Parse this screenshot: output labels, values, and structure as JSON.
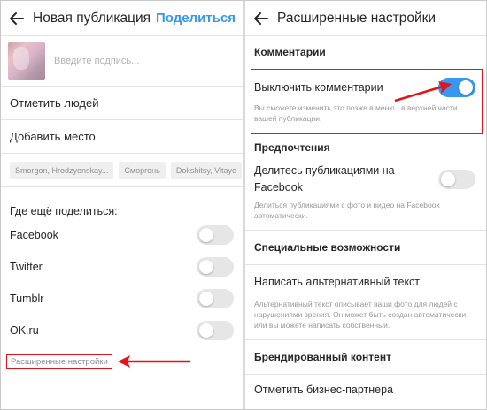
{
  "left": {
    "title": "Новая публикация",
    "share_label": "Поделиться",
    "back_icon": "back-arrow-icon",
    "caption_placeholder": "Введите подпись...",
    "tag_people": "Отметить людей",
    "add_location": "Добавить место",
    "location_chips": [
      "Smorgon, Hrodzyenskay...",
      "Сморгонь",
      "Dokshitsy, Vitaye"
    ],
    "share_elsewhere_label": "Где ещё поделиться:",
    "share_targets": [
      {
        "label": "Facebook",
        "on": false
      },
      {
        "label": "Twitter",
        "on": false
      },
      {
        "label": "Tumblr",
        "on": false
      },
      {
        "label": "OK.ru",
        "on": false
      }
    ],
    "advanced_settings": "Расширенные настройки"
  },
  "right": {
    "title": "Расширенные настройки",
    "back_icon": "back-arrow-icon",
    "comments_section": "Комментарии",
    "disable_comments": "Выключить комментарии",
    "disable_comments_on": true,
    "disable_comments_hint": "Вы сможете изменить это позже в меню ⁝ в верхней части вашей публикации.",
    "preferences_section": "Предпочтения",
    "share_fb_label": "Делитесь публикациями на Facebook",
    "share_fb_on": false,
    "share_fb_hint": "Делиться публикациями с фото и видео на Facebook автоматически.",
    "accessibility_section": "Специальные возможности",
    "alt_text": "Написать альтернативный текст",
    "alt_text_hint": "Альтернативный текст описывает ваши фото для людей с нарушениями зрения. Он может быть создан автоматически или вы можете написать собственный.",
    "branded_section": "Брендированный контент",
    "tag_partner": "Отметить бизнес-партнера"
  },
  "colors": {
    "accent": "#3897f0",
    "highlight": "#e2131b",
    "toggle_off": "#e6e6e6"
  }
}
